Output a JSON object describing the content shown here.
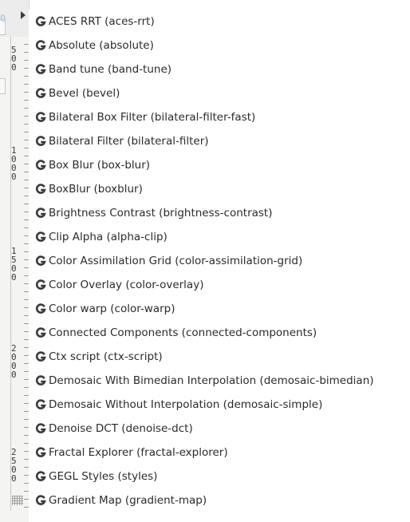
{
  "menu": {
    "items": [
      {
        "label": "ACES RRT (aces-rrt)",
        "icon": "gegl-g-icon"
      },
      {
        "label": "Absolute (absolute)",
        "icon": "gegl-g-icon"
      },
      {
        "label": "Band tune (band-tune)",
        "icon": "gegl-g-icon"
      },
      {
        "label": "Bevel (bevel)",
        "icon": "gegl-g-icon"
      },
      {
        "label": "Bilateral Box Filter (bilateral-filter-fast)",
        "icon": "gegl-g-icon"
      },
      {
        "label": "Bilateral Filter (bilateral-filter)",
        "icon": "gegl-g-icon"
      },
      {
        "label": "Box Blur (box-blur)",
        "icon": "gegl-g-icon"
      },
      {
        "label": "BoxBlur (boxblur)",
        "icon": "gegl-g-icon"
      },
      {
        "label": "Brightness Contrast (brightness-contrast)",
        "icon": "gegl-g-icon"
      },
      {
        "label": "Clip Alpha (alpha-clip)",
        "icon": "gegl-g-icon"
      },
      {
        "label": "Color Assimilation Grid (color-assimilation-grid)",
        "icon": "gegl-g-icon"
      },
      {
        "label": "Color Overlay (color-overlay)",
        "icon": "gegl-g-icon"
      },
      {
        "label": "Color warp (color-warp)",
        "icon": "gegl-g-icon"
      },
      {
        "label": "Connected Components (connected-components)",
        "icon": "gegl-g-icon"
      },
      {
        "label": "Ctx script (ctx-script)",
        "icon": "gegl-g-icon"
      },
      {
        "label": "Demosaic With Bimedian Interpolation (demosaic-bimedian)",
        "icon": "gegl-g-icon"
      },
      {
        "label": "Demosaic Without Interpolation (demosaic-simple)",
        "icon": "gegl-g-icon"
      },
      {
        "label": "Denoise DCT (denoise-dct)",
        "icon": "gegl-g-icon"
      },
      {
        "label": "Fractal Explorer (fractal-explorer)",
        "icon": "gegl-g-icon"
      },
      {
        "label": "GEGL Styles (styles)",
        "icon": "gegl-g-icon"
      },
      {
        "label": "Gradient Map (gradient-map)",
        "icon": "gegl-g-icon"
      }
    ]
  },
  "ruler": {
    "labels": [
      "500",
      "1000",
      "1500",
      "2000",
      "2500"
    ]
  },
  "background": {
    "zero": "0"
  },
  "colors": {
    "icon": "#3a3a3a",
    "text": "#2b2b2b"
  }
}
